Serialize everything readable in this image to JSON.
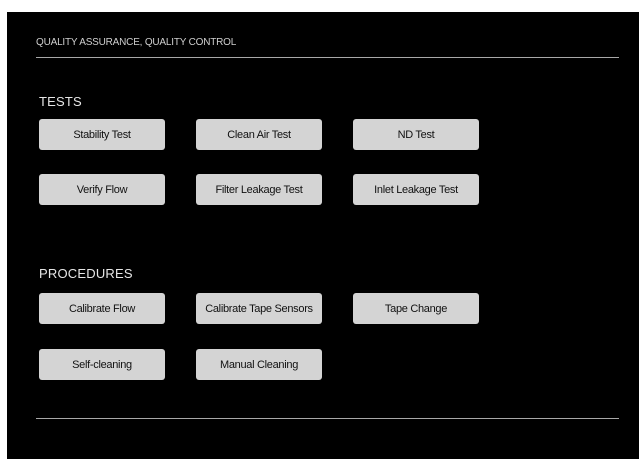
{
  "header": {
    "title": "QUALITY ASSURANCE, QUALITY CONTROL"
  },
  "tests": {
    "heading": "TESTS",
    "buttons": [
      {
        "label": "Stability Test"
      },
      {
        "label": "Clean Air Test"
      },
      {
        "label": "ND Test"
      },
      {
        "label": "Verify Flow"
      },
      {
        "label": "Filter Leakage Test"
      },
      {
        "label": "Inlet Leakage Test"
      }
    ]
  },
  "procedures": {
    "heading": "PROCEDURES",
    "buttons": [
      {
        "label": "Calibrate Flow"
      },
      {
        "label": "Calibrate Tape Sensors"
      },
      {
        "label": "Tape Change"
      },
      {
        "label": "Self-cleaning"
      },
      {
        "label": "Manual Cleaning"
      }
    ]
  }
}
